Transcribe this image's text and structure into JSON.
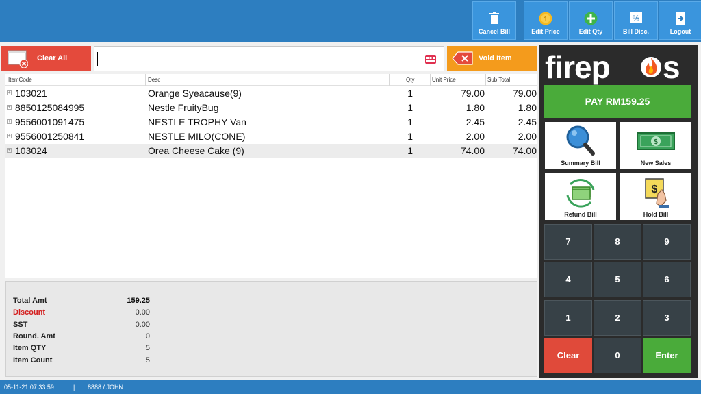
{
  "toolbar": {
    "cancel_bill": "Cancel Bill",
    "edit_price": "Edit Price",
    "edit_qty": "Edit Qty",
    "bill_disc": "Bill Disc.",
    "logout": "Logout"
  },
  "actions": {
    "clear_all": "Clear All",
    "void_item": "Void Item",
    "scan_value": ""
  },
  "grid": {
    "headers": [
      "ItemCode",
      "Desc",
      "Qty",
      "Unit Price",
      "Sub Total"
    ],
    "rows": [
      {
        "code": "103021",
        "desc": "Orange Syeacause(9)",
        "qty": "1",
        "price": "79.00",
        "sub": "79.00"
      },
      {
        "code": "8850125084995",
        "desc": "Nestle FruityBug",
        "qty": "1",
        "price": "1.80",
        "sub": "1.80"
      },
      {
        "code": "9556001091475",
        "desc": "NESTLE TROPHY Van",
        "qty": "1",
        "price": "2.45",
        "sub": "2.45"
      },
      {
        "code": "9556001250841",
        "desc": "NESTLE MILO(CONE)",
        "qty": "1",
        "price": "2.00",
        "sub": "2.00"
      },
      {
        "code": "103024",
        "desc": "Orea Cheese Cake (9)",
        "qty": "1",
        "price": "74.00",
        "sub": "74.00"
      }
    ]
  },
  "summary": {
    "total_amt_label": "Total Amt",
    "total_amt": "159.25",
    "discount_label": "Discount",
    "discount": "0.00",
    "sst_label": "SST",
    "sst": "0.00",
    "round_label": "Round. Amt",
    "round": "0",
    "item_qty_label": "Item QTY",
    "item_qty": "5",
    "item_count_label": "Item Count",
    "item_count": "5"
  },
  "status": {
    "datetime": "05-11-21  07:33:59",
    "separator": "|",
    "user": "8888  /  JOHN"
  },
  "panel": {
    "logo": "firepos",
    "pay": "PAY RM159.25",
    "summary_bill": "Summary Bill",
    "new_sales": "New Sales",
    "refund_bill": "Refund Bill",
    "hold_bill": "Hold Bill"
  },
  "keypad": {
    "k7": "7",
    "k8": "8",
    "k9": "9",
    "k4": "4",
    "k5": "5",
    "k6": "6",
    "k1": "1",
    "k2": "2",
    "k3": "3",
    "clear": "Clear",
    "k0": "0",
    "enter": "Enter"
  },
  "colors": {
    "topbar": "#2d7ec0",
    "clear_all": "#e44a3c",
    "void_item": "#f49b1c",
    "pay": "#4aab3a",
    "key": "#374147"
  },
  "icons": {
    "cancel_bill": "trash-icon",
    "edit_price": "coin-icon",
    "edit_qty": "plus-circle-icon",
    "bill_disc": "percent-icon",
    "logout": "logout-icon",
    "clear_all": "window-close-icon",
    "void_item": "tag-x-icon",
    "scan": "keyboard-icon",
    "summary_bill": "magnifier-icon",
    "new_sales": "banknote-icon",
    "refund_bill": "refund-cash-icon",
    "hold_bill": "hand-dollar-icon"
  }
}
